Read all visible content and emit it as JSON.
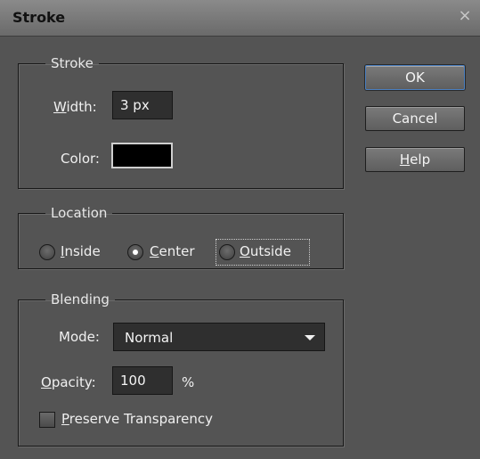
{
  "window": {
    "title": "Stroke",
    "close_glyph": "×"
  },
  "stroke_group": {
    "legend": "Stroke",
    "width_label": "Width:",
    "width_value": "3 px",
    "color_label": "Color:",
    "color_value": "#000000"
  },
  "buttons": {
    "ok": "OK",
    "cancel": "Cancel",
    "help": "Help"
  },
  "location_group": {
    "legend": "Location",
    "options": [
      {
        "label": "Inside",
        "selected": false
      },
      {
        "label": "Center",
        "selected": true
      },
      {
        "label": "Outside",
        "selected": false
      }
    ]
  },
  "blending_group": {
    "legend": "Blending",
    "mode_label": "Mode:",
    "mode_value": "Normal",
    "opacity_label": "Opacity:",
    "opacity_value": "100",
    "opacity_unit": "%",
    "preserve_label": "Preserve Transparency",
    "preserve_checked": false
  },
  "icons": {
    "close": "close-icon",
    "dropdown": "chevron-down-icon"
  }
}
